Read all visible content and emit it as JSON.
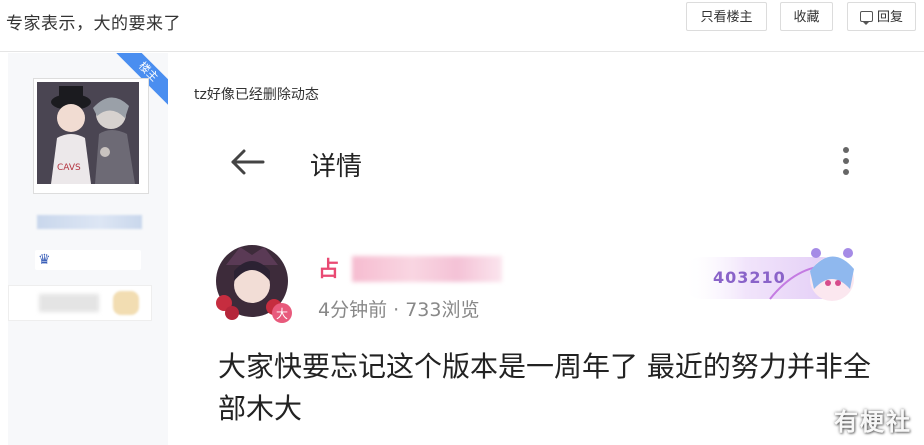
{
  "header": {
    "thread_title": "专家表示，大的要来了",
    "only_op_label": "只看楼主",
    "favorite_label": "收藏",
    "reply_label": "回复"
  },
  "sidebar": {
    "op_ribbon": "楼主"
  },
  "post": {
    "note": "tz好像已经删除动态",
    "detail_title": "详情",
    "author_name_visible": "占",
    "author_avatar_badge": "大",
    "meta": "4分钟前 · 733浏览",
    "fan_badge_number": "403210",
    "content": "大家快要忘记这个版本是一周年了 最近的努力并非全部木大"
  },
  "watermark": "有梗社",
  "colors": {
    "op_ribbon": "#4a8ef0",
    "author_name": "#e94a73",
    "fan_badge_text": "#8a63c9"
  },
  "icons": {
    "back": "arrow-left-icon",
    "more": "more-vertical-icon",
    "reply": "speech-bubble-icon",
    "badge": "crest-icon"
  }
}
